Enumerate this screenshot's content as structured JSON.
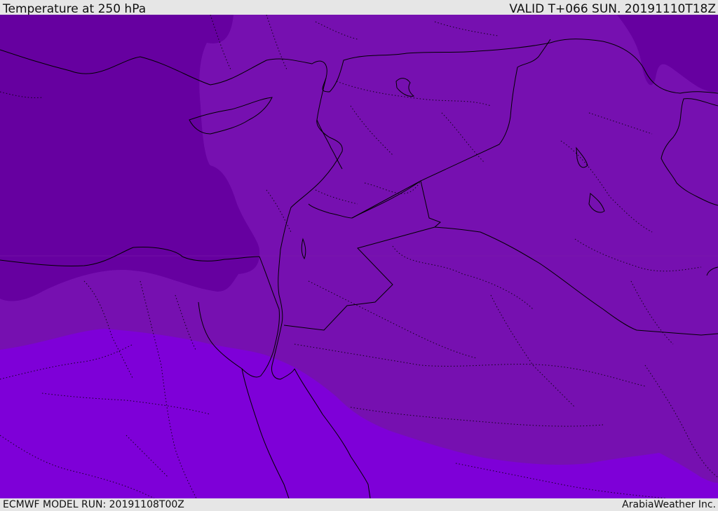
{
  "header": {
    "title": "Temperature at 250 hPa",
    "valid_time": "VALID T+066 SUN. 20191110T18Z"
  },
  "footer": {
    "model_run": "ECMWF MODEL RUN: 20191108T00Z",
    "credit": "ArabiaWeather Inc."
  },
  "map": {
    "fill_colors": {
      "coldest": "#6600a0",
      "cold": "#7610b0",
      "warm": "#7e00d8"
    },
    "border_color": "#000000"
  }
}
